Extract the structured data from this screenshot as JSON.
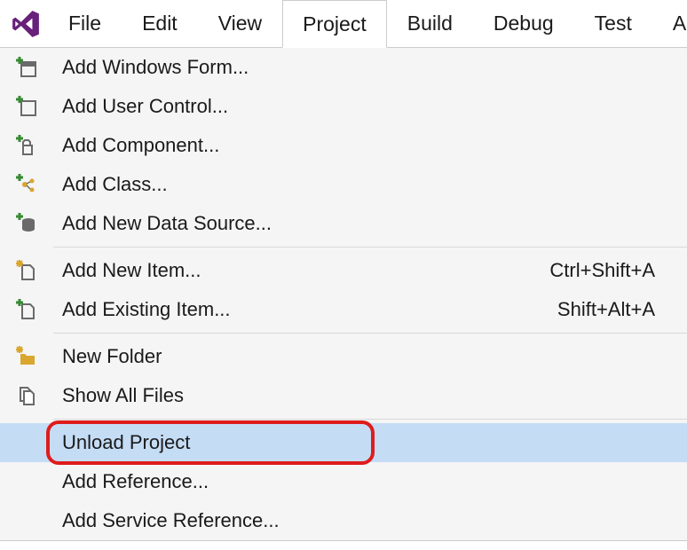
{
  "menubar": {
    "items": [
      "File",
      "Edit",
      "View",
      "Project",
      "Build",
      "Debug",
      "Test",
      "Ana"
    ],
    "active_index": 3
  },
  "dropdown": {
    "groups": [
      [
        {
          "icon": "add-form-icon",
          "label": "Add Windows Form...",
          "shortcut": ""
        },
        {
          "icon": "add-usercontrol-icon",
          "label": "Add User Control...",
          "shortcut": ""
        },
        {
          "icon": "add-component-icon",
          "label": "Add Component...",
          "shortcut": ""
        },
        {
          "icon": "add-class-icon",
          "label": "Add Class...",
          "shortcut": ""
        },
        {
          "icon": "add-datasource-icon",
          "label": "Add New Data Source...",
          "shortcut": ""
        }
      ],
      [
        {
          "icon": "new-item-icon",
          "label": "Add New Item...",
          "shortcut": "Ctrl+Shift+A"
        },
        {
          "icon": "existing-item-icon",
          "label": "Add Existing Item...",
          "shortcut": "Shift+Alt+A"
        }
      ],
      [
        {
          "icon": "new-folder-icon",
          "label": "New Folder",
          "shortcut": ""
        },
        {
          "icon": "show-all-files-icon",
          "label": "Show All Files",
          "shortcut": ""
        }
      ],
      [
        {
          "icon": "",
          "label": "Unload Project",
          "shortcut": "",
          "highlighted": true,
          "ring": true
        },
        {
          "icon": "",
          "label": "Add Reference...",
          "shortcut": ""
        },
        {
          "icon": "",
          "label": "Add Service Reference...",
          "shortcut": ""
        }
      ]
    ]
  },
  "colors": {
    "vs_purple": "#68217a",
    "highlight": "#c5dcf5",
    "ring": "#de1c1c",
    "icon_green": "#388a34",
    "icon_yellow": "#d9a62e",
    "icon_gray": "#6a6a6a"
  }
}
